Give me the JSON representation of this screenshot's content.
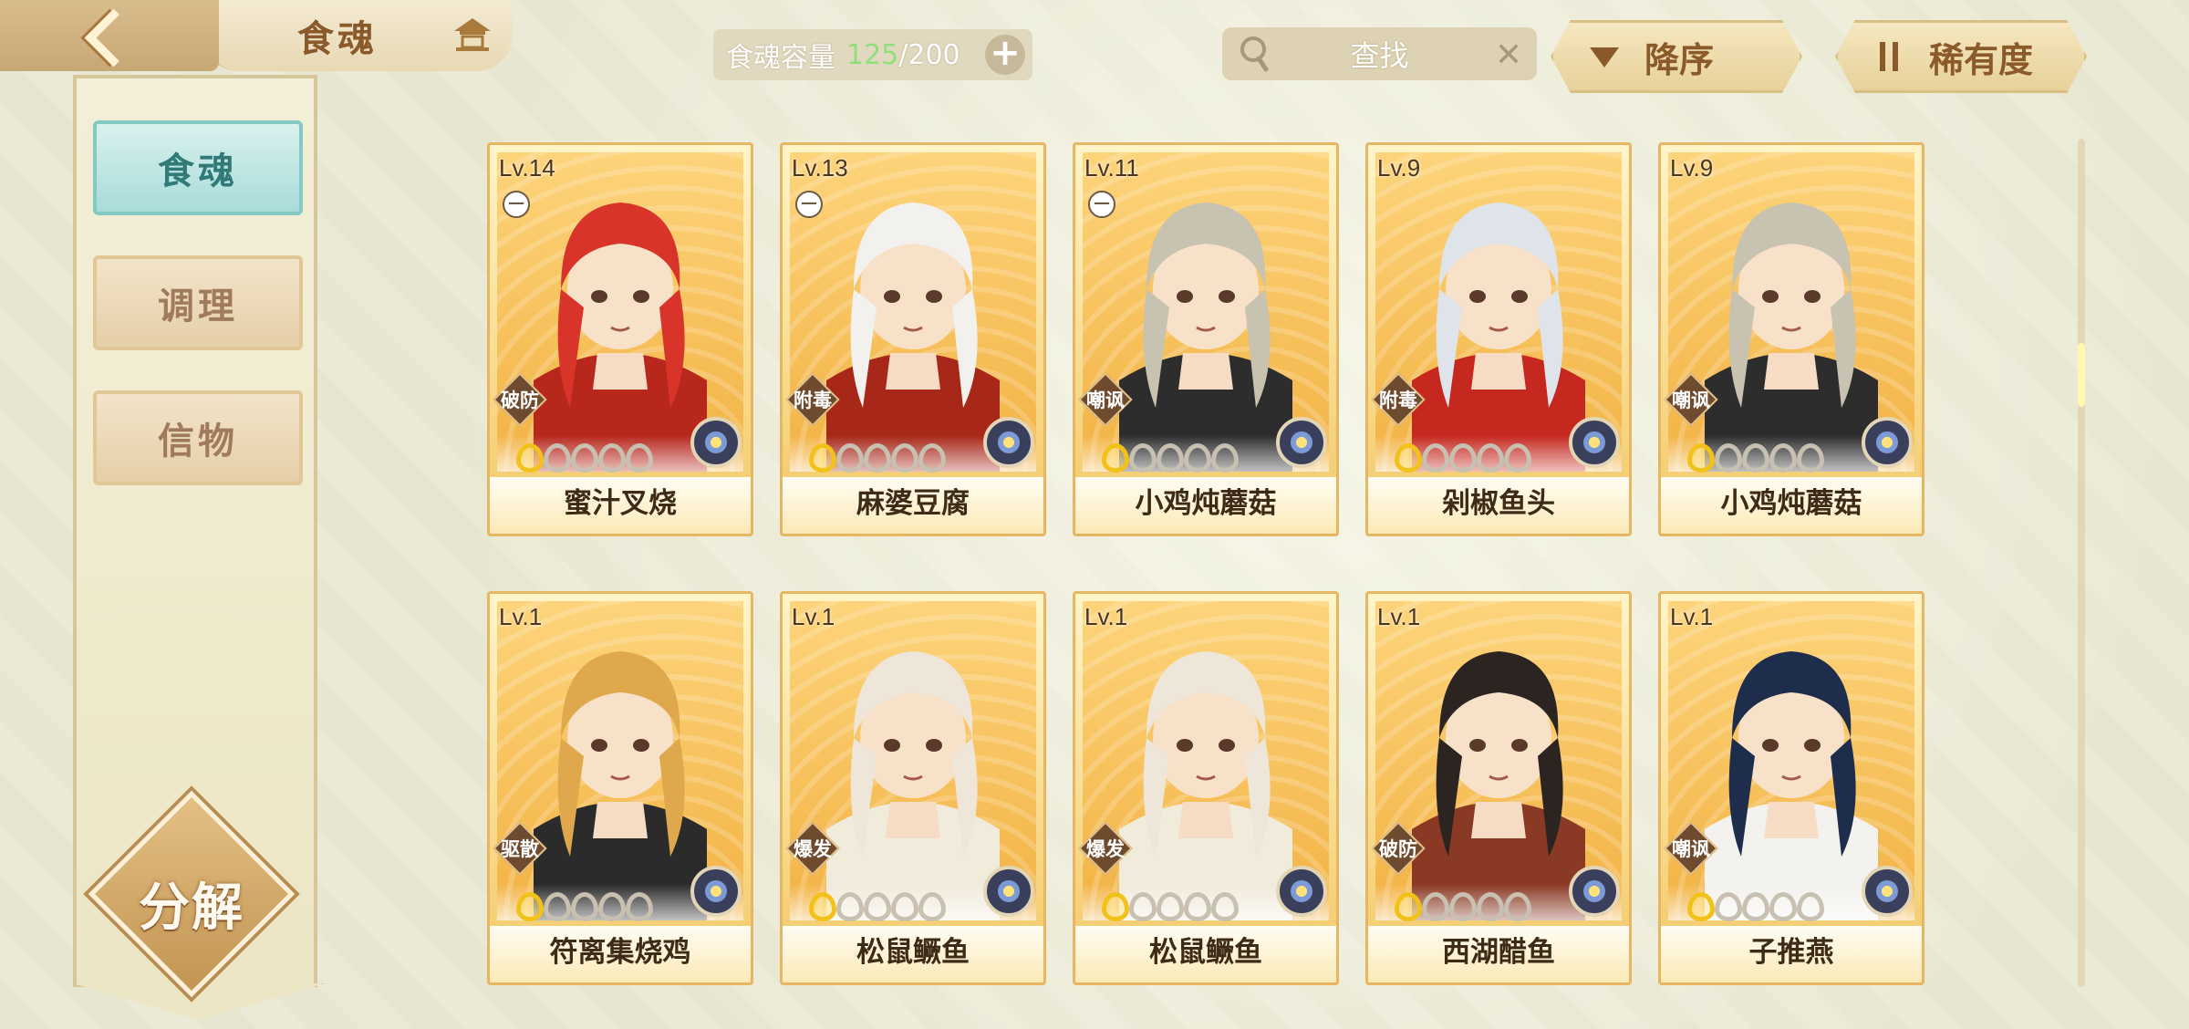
{
  "header": {
    "title": "食魂",
    "capacity_label": "食魂容量",
    "capacity_current": "125",
    "capacity_max": "/200",
    "add_label": "+",
    "search_placeholder": "查找",
    "sort_order_label": "降序",
    "sort_field_label": "稀有度"
  },
  "sidebar": {
    "tabs": [
      {
        "label": "食魂",
        "active": true
      },
      {
        "label": "调理",
        "active": false
      },
      {
        "label": "信物",
        "active": false
      }
    ],
    "decompose_label": "分解"
  },
  "cards": [
    {
      "level": "Lv.14",
      "name": "蜜汁叉烧",
      "role": "破防",
      "locked": true,
      "stars_lit": 1,
      "stars_total": 5,
      "hair": "#d8342a",
      "outfit": "#b7271c"
    },
    {
      "level": "Lv.13",
      "name": "麻婆豆腐",
      "role": "附毒",
      "locked": true,
      "stars_lit": 1,
      "stars_total": 5,
      "hair": "#f3f1ee",
      "outfit": "#a72718"
    },
    {
      "level": "Lv.11",
      "name": "小鸡炖蘑菇",
      "role": "嘲讽",
      "locked": true,
      "stars_lit": 1,
      "stars_total": 5,
      "hair": "#c8c2b0",
      "outfit": "#2d2d2d"
    },
    {
      "level": "Lv.9",
      "name": "剁椒鱼头",
      "role": "附毒",
      "locked": false,
      "stars_lit": 1,
      "stars_total": 5,
      "hair": "#dfe4ea",
      "outfit": "#c5281f"
    },
    {
      "level": "Lv.9",
      "name": "小鸡炖蘑菇",
      "role": "嘲讽",
      "locked": false,
      "stars_lit": 1,
      "stars_total": 5,
      "hair": "#c8c2b0",
      "outfit": "#2d2d2d"
    },
    {
      "level": "Lv.1",
      "name": "符离集烧鸡",
      "role": "驱散",
      "locked": false,
      "stars_lit": 1,
      "stars_total": 5,
      "hair": "#e0a84c",
      "outfit": "#2b2b2b"
    },
    {
      "level": "Lv.1",
      "name": "松鼠鳜鱼",
      "role": "爆发",
      "locked": false,
      "stars_lit": 1,
      "stars_total": 5,
      "hair": "#eee6d8",
      "outfit": "#f1ebdb"
    },
    {
      "level": "Lv.1",
      "name": "松鼠鳜鱼",
      "role": "爆发",
      "locked": false,
      "stars_lit": 1,
      "stars_total": 5,
      "hair": "#eee6d8",
      "outfit": "#f1ebdb"
    },
    {
      "level": "Lv.1",
      "name": "西湖醋鱼",
      "role": "破防",
      "locked": false,
      "stars_lit": 1,
      "stars_total": 5,
      "hair": "#2b2420",
      "outfit": "#8a3a24"
    },
    {
      "level": "Lv.1",
      "name": "子推燕",
      "role": "嘲讽",
      "locked": false,
      "stars_lit": 1,
      "stars_total": 5,
      "hair": "#1f2d4d",
      "outfit": "#f4f2ee"
    }
  ]
}
